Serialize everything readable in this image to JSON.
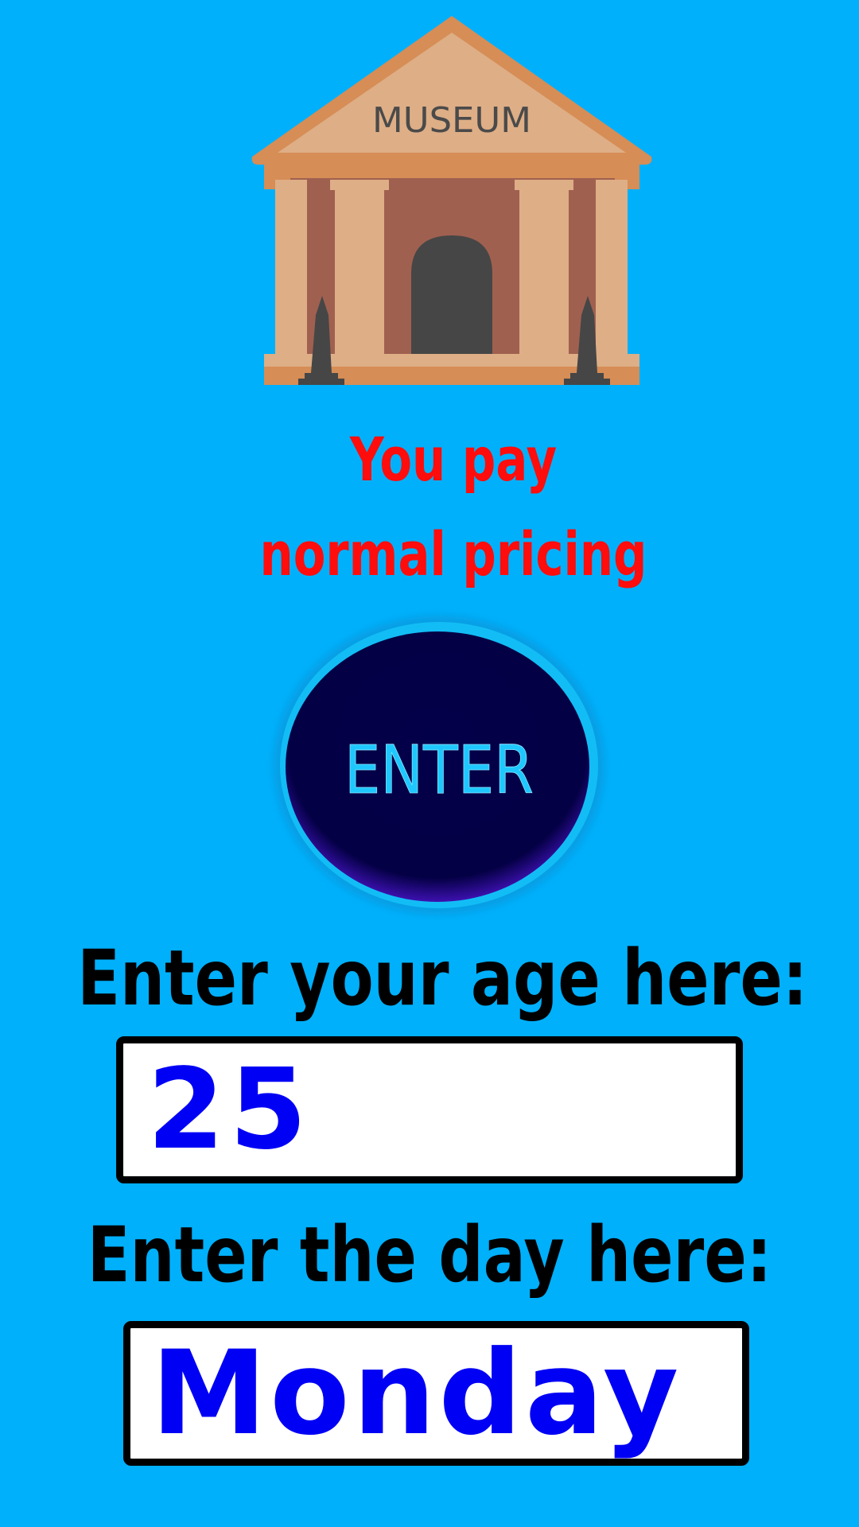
{
  "museum": {
    "sign_text": "MUSEUM",
    "icon": "museum-building-icon"
  },
  "result": {
    "line1": "You pay",
    "line2": "normal pricing",
    "color": "#ff0d0d"
  },
  "enter_button": {
    "label": "ENTER",
    "label_color": "#1ec8ff"
  },
  "age": {
    "label": "Enter your age here:",
    "value": "25"
  },
  "day": {
    "label": "Enter the day here:",
    "value": "Monday"
  },
  "colors": {
    "background": "#00b0fb",
    "input_text": "#0000f5",
    "button_fill": "#020040"
  }
}
